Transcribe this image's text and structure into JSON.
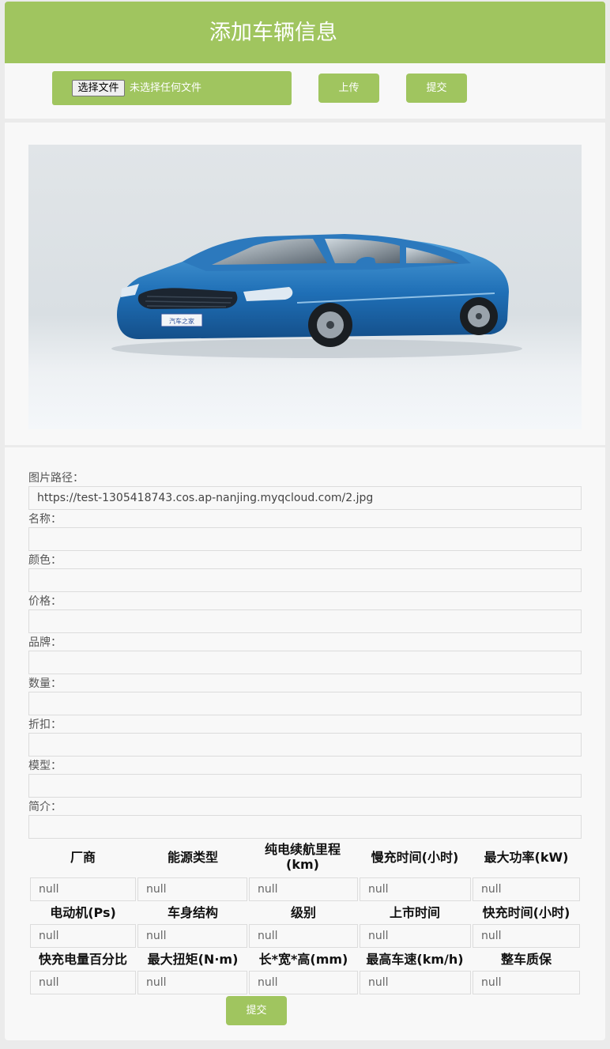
{
  "header": {
    "title": "添加车辆信息"
  },
  "upload": {
    "choose_file_label": "选择文件",
    "file_status": "未选择任何文件",
    "upload_label": "上传",
    "submit_label": "提交"
  },
  "car_image": {
    "alt": "blue sedan car photo",
    "plate_text": "汽车之家"
  },
  "form": {
    "fields": [
      {
        "label": "图片路径：",
        "value": "https://test-1305418743.cos.ap-nanjing.myqcloud.com/2.jpg"
      },
      {
        "label": "名称：",
        "value": ""
      },
      {
        "label": "颜色：",
        "value": ""
      },
      {
        "label": "价格：",
        "value": ""
      },
      {
        "label": "品牌：",
        "value": ""
      },
      {
        "label": "数量：",
        "value": ""
      },
      {
        "label": "折扣：",
        "value": ""
      },
      {
        "label": "模型：",
        "value": ""
      },
      {
        "label": "简介：",
        "value": ""
      }
    ],
    "spec_rows": [
      {
        "headers": [
          "厂商",
          "能源类型",
          "纯电续航里程(km)",
          "慢充时间(小时)",
          "最大功率(kW)"
        ],
        "values": [
          "null",
          "null",
          "null",
          "null",
          "null"
        ]
      },
      {
        "headers": [
          "电动机(Ps)",
          "车身结构",
          "级别",
          "上市时间",
          "快充时间(小时)"
        ],
        "values": [
          "null",
          "null",
          "null",
          "null",
          "null"
        ]
      },
      {
        "headers": [
          "快充电量百分比",
          "最大扭矩(N·m)",
          "长*宽*高(mm)",
          "最高车速(km/h)",
          "整车质保"
        ],
        "values": [
          "null",
          "null",
          "null",
          "null",
          "null"
        ]
      }
    ],
    "submit_label": "提交"
  },
  "colors": {
    "accent": "#a0c55f",
    "panel": "#f8f8f8",
    "background": "#ebebeb"
  }
}
